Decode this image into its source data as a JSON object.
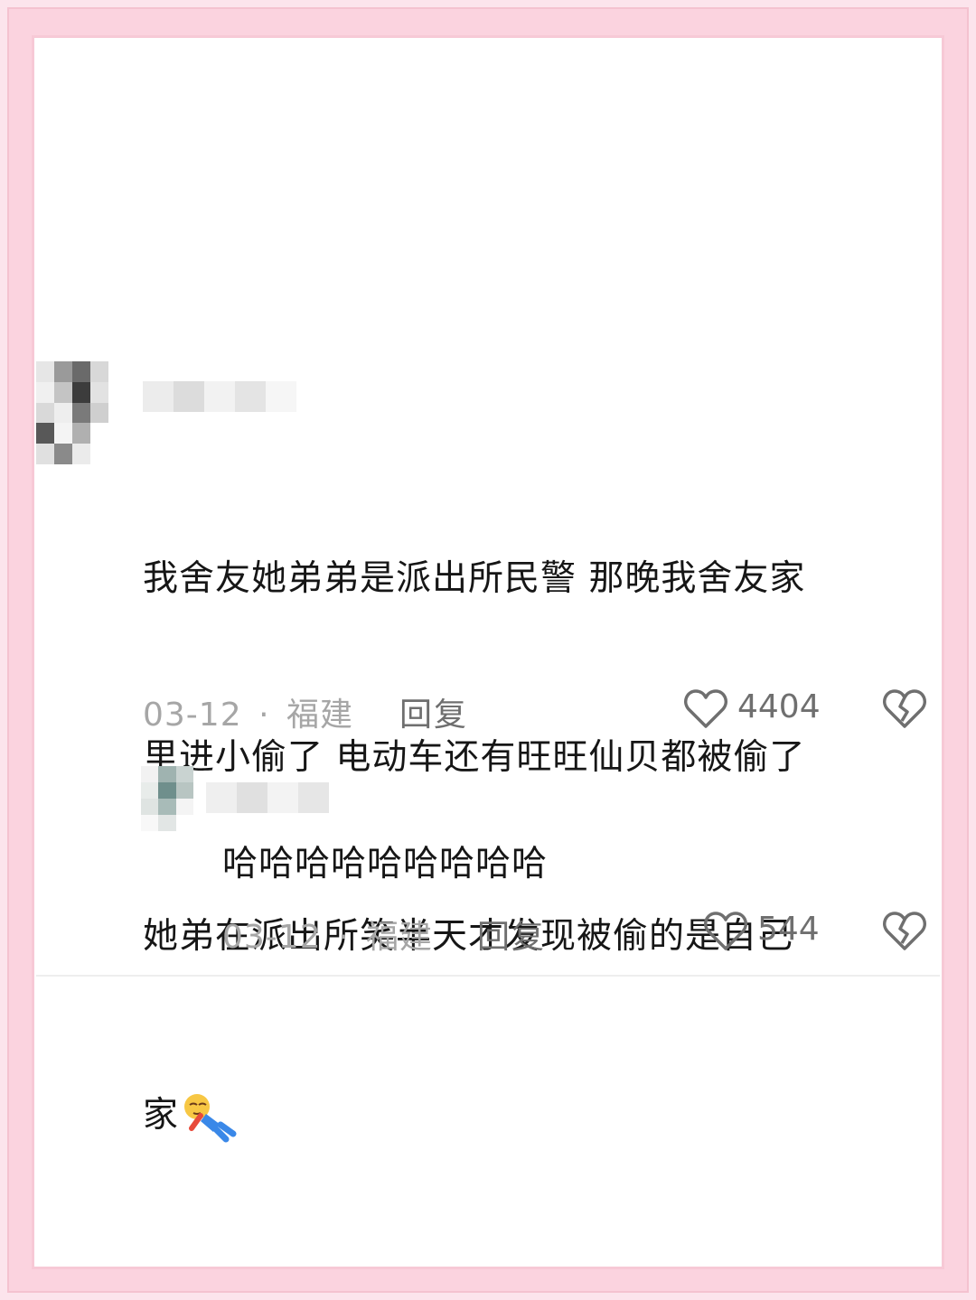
{
  "comment": {
    "text": "我舍友她弟弟是派出所民警 那晚我舍友家里进小偷了 电动车还有旺旺仙贝都被偷了她弟在派出所笑半天才发现被偷的是自己家",
    "lines": [
      "我舍友她弟弟是派出所民警 那晚我舍友家",
      "里进小偷了 电动车还有旺旺仙贝都被偷了",
      "她弟在派出所笑半天才发现被偷的是自己",
      "家"
    ],
    "emoji_icon": "tired-person-emoji",
    "date": "03-12",
    "separator": "·",
    "location": "福建",
    "reply_label": "回复",
    "like_count": "4404",
    "like_icon": "heart-outline-icon",
    "dislike_icon": "broken-heart-icon"
  },
  "reply": {
    "text": "哈哈哈哈哈哈哈哈哈",
    "date": "03-12",
    "separator": "·",
    "location": "福建",
    "reply_label": "回复",
    "like_count": "544",
    "like_icon": "heart-outline-icon",
    "dislike_icon": "broken-heart-icon"
  },
  "colors": {
    "frame_pink": "#fbd3df",
    "text": "#161616",
    "meta_gray": "#a6a6a6",
    "action_gray": "#6f6f6f"
  }
}
